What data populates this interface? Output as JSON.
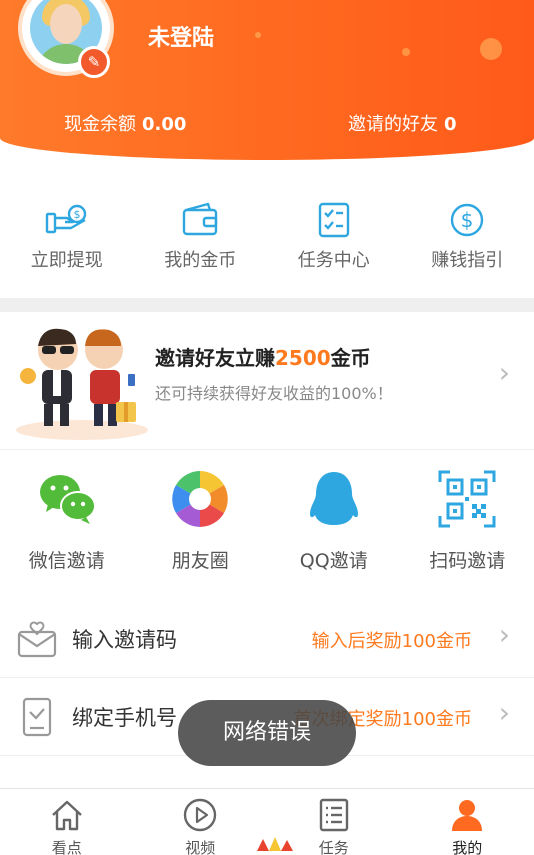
{
  "header": {
    "username": "未登陆",
    "cash_label": "现金余额",
    "cash_value": "0.00",
    "friends_label": "邀请的好友",
    "friends_value": "0"
  },
  "quick_actions": [
    {
      "label": "立即提现",
      "icon": "cash-hand-icon"
    },
    {
      "label": "我的金币",
      "icon": "wallet-icon"
    },
    {
      "label": "任务中心",
      "icon": "task-list-icon"
    },
    {
      "label": "赚钱指引",
      "icon": "dollar-coin-icon"
    }
  ],
  "banner": {
    "title_prefix": "邀请好友立赚",
    "title_amount": "2500",
    "title_suffix": "金币",
    "subtitle": "还可持续获得好友收益的100%！"
  },
  "share_options": [
    {
      "label": "微信邀请",
      "icon": "wechat-icon"
    },
    {
      "label": "朋友圈",
      "icon": "moments-icon"
    },
    {
      "label": "QQ邀请",
      "icon": "qq-icon"
    },
    {
      "label": "扫码邀请",
      "icon": "qrcode-icon"
    }
  ],
  "list": [
    {
      "label": "输入邀请码",
      "right": "输入后奖励100金币",
      "icon": "invite-code-icon"
    },
    {
      "label": "绑定手机号",
      "right": "首次绑定奖励100金币",
      "icon": "phone-icon"
    }
  ],
  "toast": "网络错误",
  "tabs": [
    {
      "label": "看点",
      "icon": "home-icon"
    },
    {
      "label": "视频",
      "icon": "play-icon"
    },
    {
      "label": "任务",
      "icon": "task-icon"
    },
    {
      "label": "我的",
      "icon": "profile-icon",
      "active": true
    }
  ],
  "colors": {
    "accent": "#ff6a20",
    "highlight": "#ff7a1e",
    "icon_blue": "#2ea7e0"
  }
}
